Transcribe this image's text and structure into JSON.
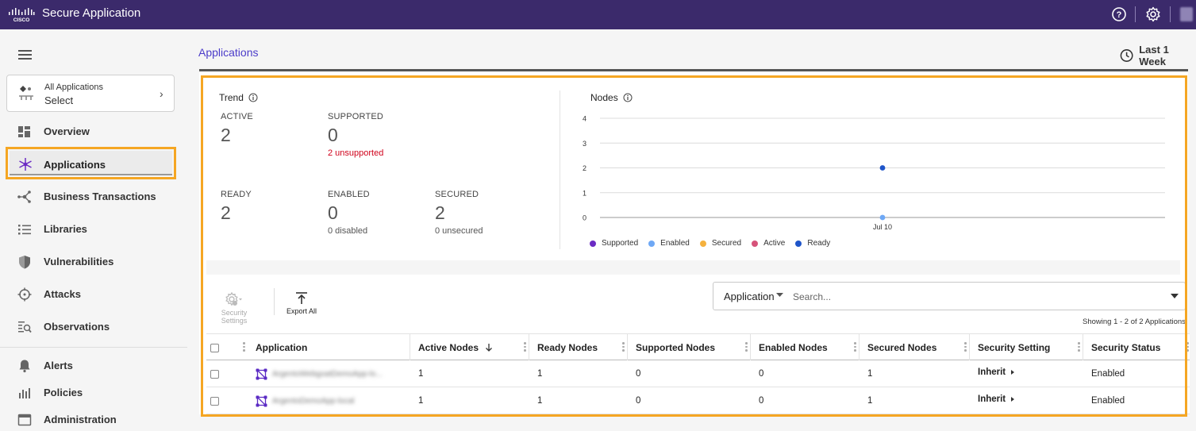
{
  "topbar": {
    "brand": "Secure Application",
    "icons": [
      "cisco-logo",
      "help-icon",
      "settings-icon",
      "user-avatar"
    ]
  },
  "sidebar": {
    "app_selector": {
      "title": "All Applications",
      "value": "Select"
    },
    "items": [
      {
        "label": "Overview",
        "icon": "overview-icon"
      },
      {
        "label": "Applications",
        "icon": "applications-icon",
        "active": true
      },
      {
        "label": "Business Transactions",
        "icon": "business-transactions-icon"
      },
      {
        "label": "Libraries",
        "icon": "libraries-icon"
      },
      {
        "label": "Vulnerabilities",
        "icon": "shield-icon"
      },
      {
        "label": "Attacks",
        "icon": "crosshair-icon"
      },
      {
        "label": "Observations",
        "icon": "observations-icon"
      },
      {
        "label": "Alerts",
        "icon": "bell-icon"
      },
      {
        "label": "Policies",
        "icon": "policies-icon"
      },
      {
        "label": "Administration",
        "icon": "administration-icon"
      }
    ]
  },
  "main": {
    "breadcrumb": "Applications",
    "time_range": "Last 1 Week",
    "trend": {
      "title": "Trend",
      "stats": {
        "active": {
          "label": "ACTIVE",
          "value": "2"
        },
        "supported": {
          "label": "SUPPORTED",
          "value": "0",
          "sub": "2 unsupported"
        },
        "ready": {
          "label": "READY",
          "value": "2"
        },
        "enabled": {
          "label": "ENABLED",
          "value": "0",
          "sub": "0 disabled"
        },
        "secured": {
          "label": "SECURED",
          "value": "2",
          "sub": "0 unsecured"
        }
      }
    },
    "nodes": {
      "title": "Nodes"
    },
    "toolbar": {
      "security_settings": "Security Settings",
      "export_all": "Export All"
    },
    "search": {
      "dropdown": "Application",
      "placeholder": "Search..."
    },
    "showing": "Showing 1 - 2 of 2 Applications",
    "table": {
      "columns": [
        "Application",
        "Active Nodes",
        "Ready Nodes",
        "Supported Nodes",
        "Enabled Nodes",
        "Secured Nodes",
        "Security Setting",
        "Security Status"
      ],
      "rows": [
        {
          "application": "ArgentoWebgoatDemoApp-lo...",
          "active_nodes": "1",
          "ready_nodes": "1",
          "supported_nodes": "0",
          "enabled_nodes": "0",
          "secured_nodes": "1",
          "security_setting": "Inherit",
          "security_status": "Enabled"
        },
        {
          "application": "ArgentoDemoApp-local",
          "active_nodes": "1",
          "ready_nodes": "1",
          "supported_nodes": "0",
          "enabled_nodes": "0",
          "secured_nodes": "1",
          "security_setting": "Inherit",
          "security_status": "Enabled"
        }
      ]
    }
  },
  "chart_data": {
    "type": "scatter",
    "title": "Nodes",
    "xlabel": "",
    "ylabel": "",
    "x_ticks": [
      "Jul 10"
    ],
    "y_ticks": [
      0,
      1,
      2,
      3,
      4
    ],
    "ylim": [
      0,
      4
    ],
    "grid": true,
    "legend_position": "bottom",
    "series": [
      {
        "name": "Supported",
        "color": "#6b2bc4",
        "points": []
      },
      {
        "name": "Enabled",
        "color": "#6ea8f5",
        "points": [
          {
            "x": "Jul 10",
            "y": 0
          }
        ]
      },
      {
        "name": "Secured",
        "color": "#f5b13d",
        "points": []
      },
      {
        "name": "Active",
        "color": "#d6537a",
        "points": []
      },
      {
        "name": "Ready",
        "color": "#1f55c9",
        "points": [
          {
            "x": "Jul 10",
            "y": 2
          }
        ]
      }
    ]
  },
  "colors": {
    "topbar": "#3b2a6b",
    "accent": "#4b3cc9",
    "highlight": "#f5a623",
    "danger": "#d0021b"
  }
}
